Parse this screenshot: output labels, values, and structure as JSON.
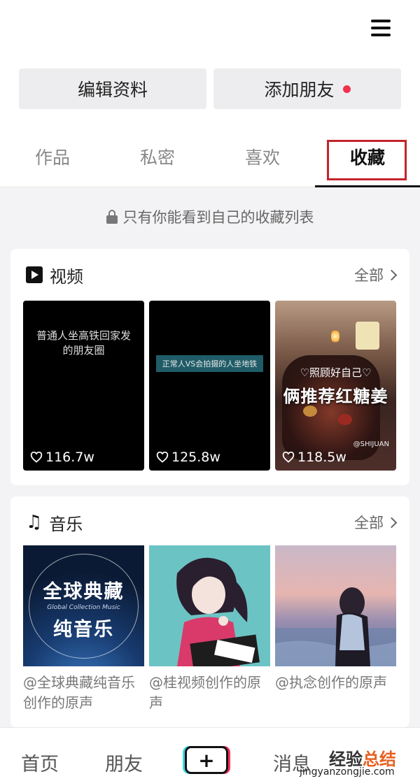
{
  "header": {
    "menu_icon": "hamburger-menu-icon"
  },
  "actions": {
    "edit_profile": "编辑资料",
    "add_friends": "添加朋友",
    "accent_color": "#f0304c"
  },
  "tabs": [
    {
      "label": "作品"
    },
    {
      "label": "私密"
    },
    {
      "label": "喜欢"
    },
    {
      "label": "收藏"
    }
  ],
  "active_tab": "收藏",
  "privacy_note": "只有你能看到自己的收藏列表",
  "video_section": {
    "title": "视频",
    "all_label": "全部",
    "items": [
      {
        "text": "普通人坐高铁回家发的朋友圈",
        "likes": "116.7w"
      },
      {
        "text": "正常人VS会拍摄的人坐地铁",
        "likes": "125.8w"
      },
      {
        "text_small": "♡照顾好自己♡",
        "text_big": "俩推荐红糖姜",
        "handle": "@SHIJUAN",
        "likes": "118.5w"
      }
    ]
  },
  "music_section": {
    "title": "音乐",
    "all_label": "全部",
    "items": [
      {
        "cover_title": "全球典藏",
        "cover_subtitle": "Global Collection Music",
        "cover_title2": "纯音乐",
        "label": "@全球典藏纯音乐创作的原声"
      },
      {
        "label": "@桂视频创作的原声"
      },
      {
        "label": "@执念创作的原声"
      }
    ]
  },
  "bottom_nav": {
    "home": "首页",
    "friends": "朋友",
    "create": "+",
    "messages": "消息"
  },
  "watermark": {
    "text_a": "经验",
    "text_b": "总结",
    "url": "jingyanzongjie.com"
  }
}
